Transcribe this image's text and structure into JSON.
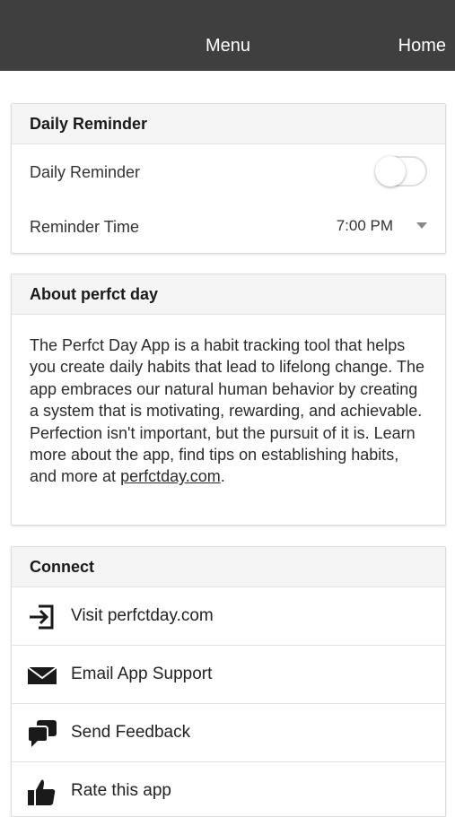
{
  "topbar": {
    "menu_label": "Menu",
    "home_label": "Home"
  },
  "reminder_card": {
    "title": "Daily Reminder",
    "toggle_label": "Daily Reminder",
    "toggle_on": false,
    "time_label": "Reminder Time",
    "time_value": "7:00 PM"
  },
  "about_card": {
    "title": "About perfct day",
    "body": "The Perfct Day App is a habit tracking tool that helps you create daily habits that lead to lifelong change. The app embraces our natural human behavior by creating a system that is motivating, rewarding, and achievable. Perfection isn't important, but the pursuit of it is. Learn more about the app, find tips on establishing habits, and more at ",
    "link_text": "perfctday.com",
    "trailing": "."
  },
  "connect_card": {
    "title": "Connect",
    "items": [
      {
        "label": "Visit perfctday.com",
        "icon": "sign-in-icon"
      },
      {
        "label": "Email App Support",
        "icon": "envelope-icon"
      },
      {
        "label": "Send Feedback",
        "icon": "chat-bubbles-icon"
      },
      {
        "label": "Rate this app",
        "icon": "thumbs-up-icon"
      }
    ]
  },
  "colors": {
    "topbar": "#3f3f3f",
    "card_header": "#f5f5f5"
  }
}
